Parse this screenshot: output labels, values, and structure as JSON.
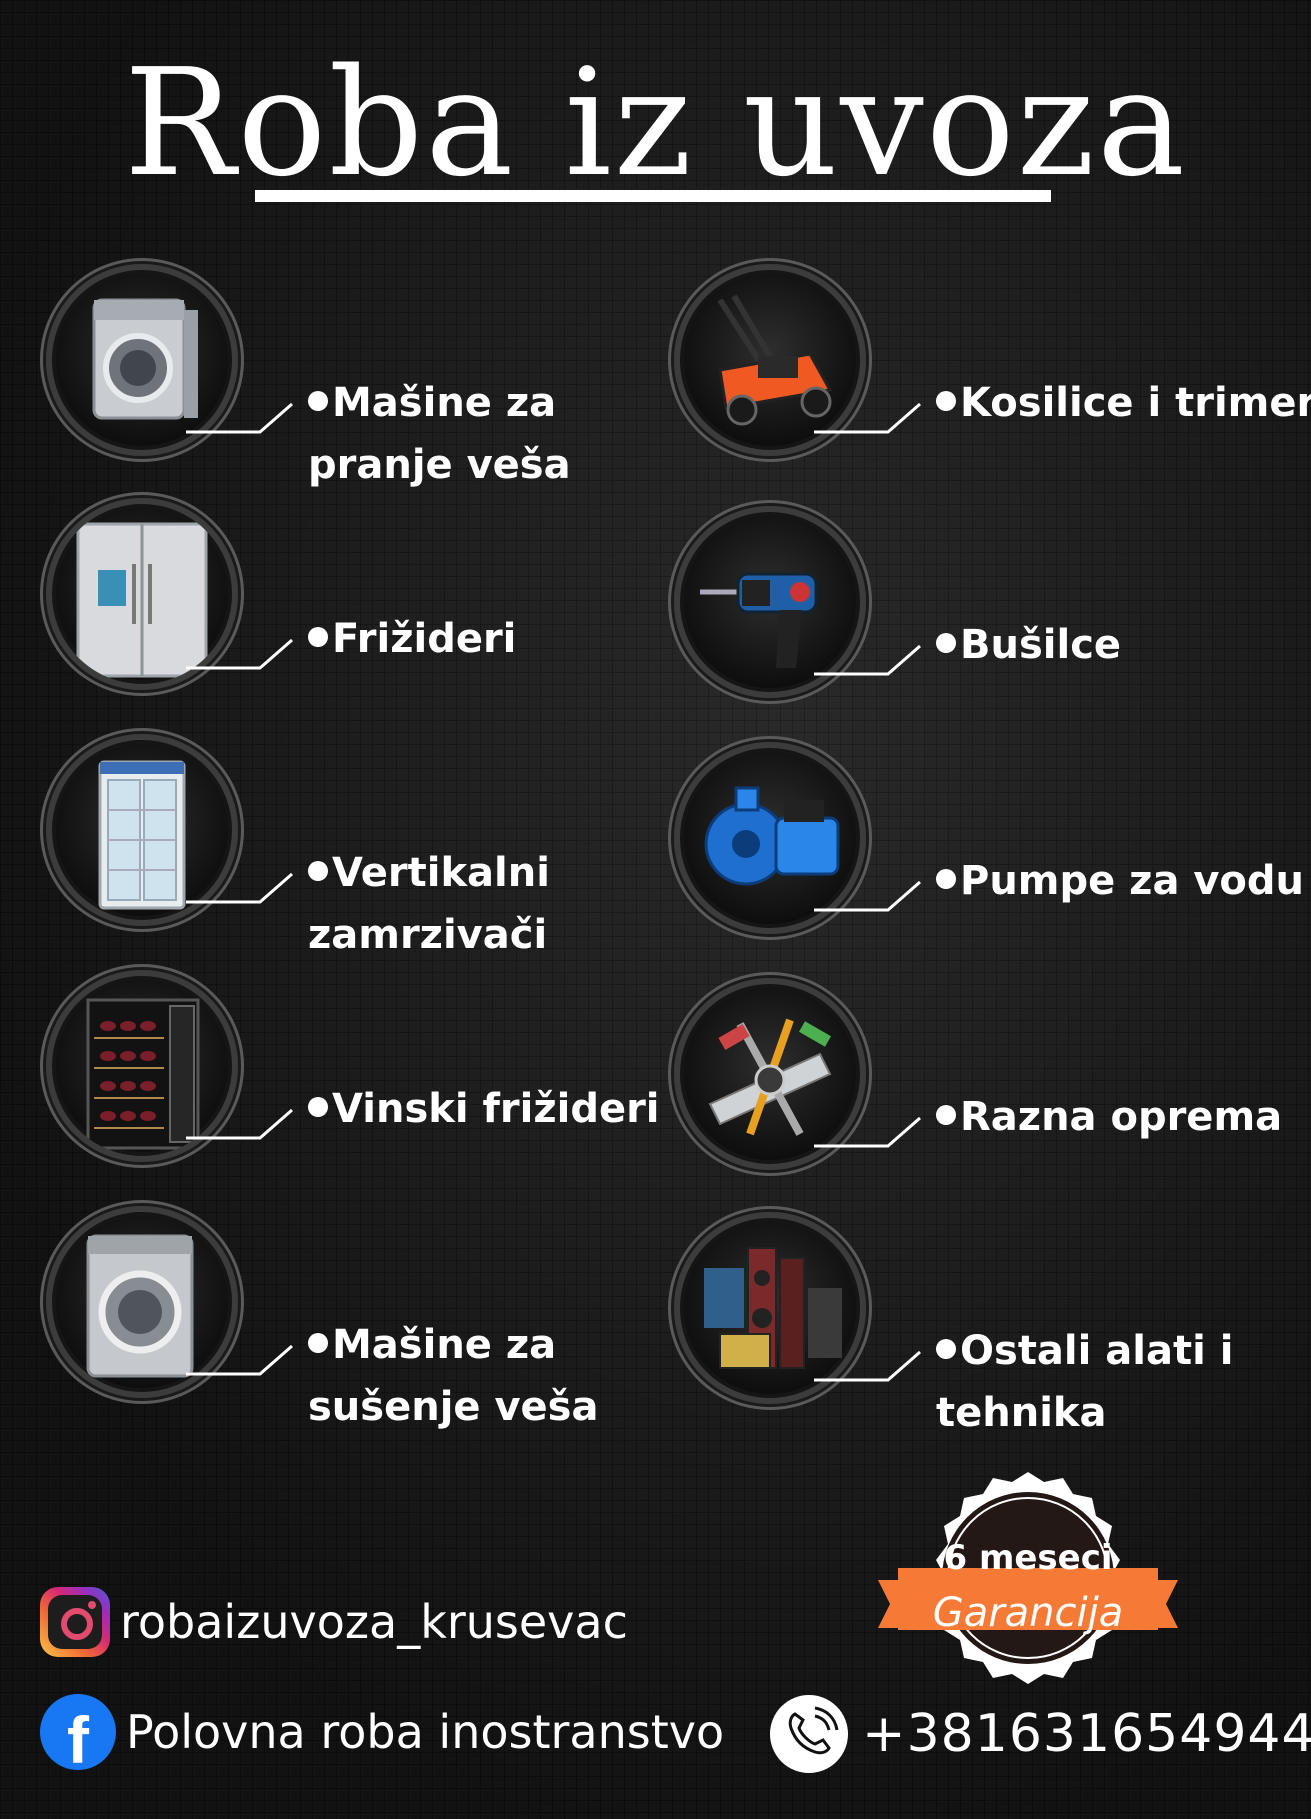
{
  "title": "Roba iz uvoza",
  "items_left": [
    {
      "line1": "Mašine za",
      "line2": "pranje veša",
      "icon": "washing-machine-icon"
    },
    {
      "line1": "Frižideri",
      "line2": "",
      "icon": "refrigerator-icon"
    },
    {
      "line1": "Vertikalni",
      "line2": "zamrzivači",
      "icon": "vertical-freezer-icon"
    },
    {
      "line1": "Vinski frižideri",
      "line2": "",
      "icon": "wine-fridge-icon"
    },
    {
      "line1": "Mašine za",
      "line2": "sušenje veša",
      "icon": "dryer-icon"
    }
  ],
  "items_right": [
    {
      "line1": "Kosilice i trimeri",
      "line2": "",
      "icon": "lawn-mower-icon"
    },
    {
      "line1": "Bušilce",
      "line2": "",
      "icon": "drill-icon"
    },
    {
      "line1": "Pumpe za vodu",
      "line2": "",
      "icon": "water-pump-icon"
    },
    {
      "line1": "Razna oprema",
      "line2": "",
      "icon": "tools-icon"
    },
    {
      "line1": "Ostali alati i",
      "line2": "tehnika",
      "icon": "electronics-icon"
    }
  ],
  "social": {
    "instagram": "robaizuvoza_krusevac",
    "facebook": "Polovna roba inostranstvo",
    "facebook_letter": "f"
  },
  "phone": "+381631654944",
  "badge": {
    "top": "6 meseci",
    "ribbon": "Garancija"
  },
  "colors": {
    "background": "#1c1c1c",
    "text": "#ffffff",
    "ribbon": "#f47a35",
    "badge": "#231815",
    "facebook": "#1877f2"
  }
}
